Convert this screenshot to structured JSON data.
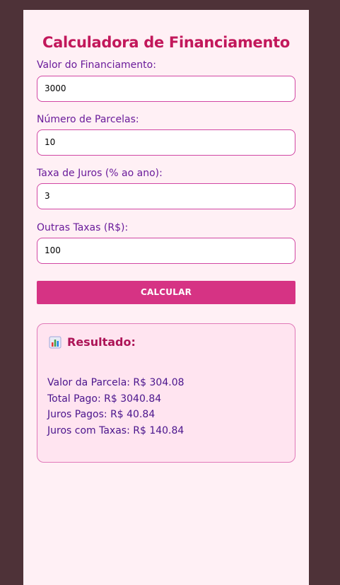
{
  "title": "Calculadora de Financiamento",
  "fields": [
    {
      "label": "Valor do Financiamento:",
      "value": "3000"
    },
    {
      "label": "Número de Parcelas:",
      "value": "10"
    },
    {
      "label": "Taxa de Juros (% ao ano):",
      "value": "3"
    },
    {
      "label": "Outras Taxas (R$):",
      "value": "100"
    }
  ],
  "button": {
    "label": "CALCULAR"
  },
  "result": {
    "icon": "bar-chart-icon",
    "title": "Resultado:",
    "lines": [
      "Valor da Parcela: R$ 304.08",
      "Total Pago: R$ 3040.84",
      "Juros Pagos: R$ 40.84",
      "Juros com Taxas: R$ 140.84"
    ]
  },
  "colors": {
    "background": "#4e3238",
    "card": "#fff0f5",
    "title": "#c2185b",
    "label": "#6a1b9a",
    "button": "#d63384",
    "result_bg": "#ffe4f0"
  }
}
